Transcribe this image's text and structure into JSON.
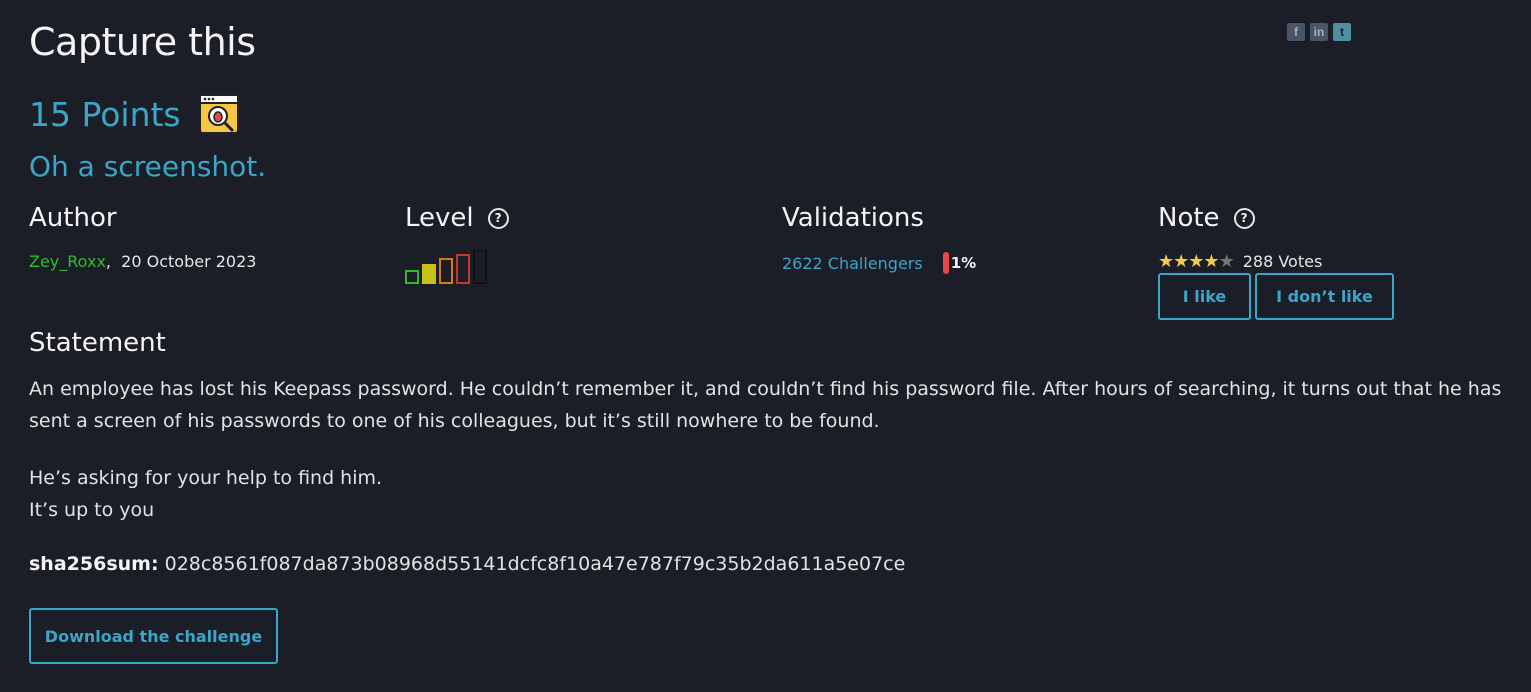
{
  "challenge": {
    "title": "Capture this",
    "points": "15 Points",
    "subtitle": "Oh a screenshot."
  },
  "share": {
    "facebook": "f",
    "linkedin": "in",
    "twitter": "t"
  },
  "author": {
    "heading": "Author",
    "name": "Zey_Roxx",
    "separator": ",",
    "date": "20 October 2023"
  },
  "level": {
    "heading": "Level",
    "current": 1,
    "max": 5,
    "colors": [
      "#2ebc2e",
      "#c9c01a",
      "#d07a1c",
      "#c0392b",
      "#111111"
    ]
  },
  "validations": {
    "heading": "Validations",
    "challengers": "2622 Challengers",
    "percent": "1%"
  },
  "note": {
    "heading": "Note",
    "rating": 4,
    "max": 5,
    "votes": "288 Votes",
    "like_label": "I like",
    "dislike_label": "I don’t like"
  },
  "statement": {
    "heading": "Statement",
    "p1": "An employee has lost his Keepass password. He couldn’t remember it, and couldn’t find his password file. After hours of searching, it turns out that he has sent a screen of his passwords to one of his colleagues, but it’s still nowhere to be found.",
    "p2_line1": "He’s asking for your help to find him.",
    "p2_line2": "It’s up to you",
    "sha_label": "sha256sum:",
    "sha_value": "028c8561f087da873b08968d55141dcfc8f10a47e787f79c35b2da611a5e07ce"
  },
  "download_label": "Download the challenge"
}
